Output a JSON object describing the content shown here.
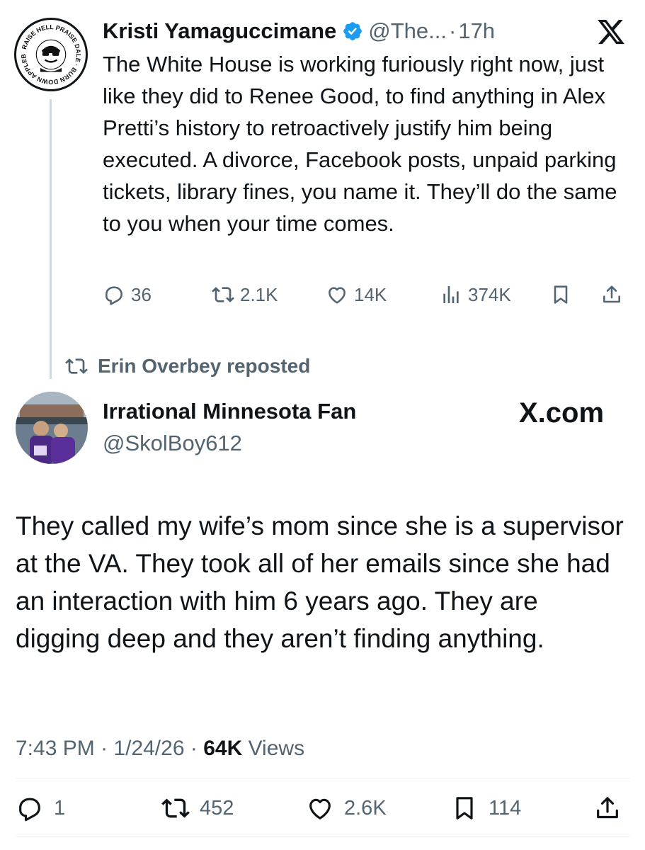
{
  "parent_tweet": {
    "display_name": "Kristi Yamaguccimane",
    "handle": "@The...",
    "separator": "·",
    "time": "17h",
    "avatar_text": "RAISE HELL PRAISE DALE BURN DOWN APPLEBEE'S",
    "text": "The White House is working furiously right now, just like they did to Renee Good, to find anything in Alex Pretti’s history to retroactively justify him being executed. A divorce, Facebook posts, unpaid parking tickets, library fines, you name it. They’ll do the same to you when your time comes.",
    "actions": {
      "replies": "36",
      "reposts": "2.1K",
      "likes": "14K",
      "views": "374K"
    }
  },
  "repost_banner": {
    "label": "Erin Overbey reposted"
  },
  "main_tweet": {
    "display_name": "Irrational Minnesota Fan",
    "handle": "@SkolBoy612",
    "brand": "X.com",
    "text": "They called my wife’s mom since she is a supervisor at the VA. They took all of her emails since she had an interaction with him 6 years ago. They are digging deep and they aren’t finding anything.",
    "meta": {
      "time": "7:43 PM",
      "separator": "·",
      "date": "1/24/26",
      "views_count": "64K",
      "views_label": "Views"
    },
    "actions": {
      "replies": "1",
      "reposts": "452",
      "likes": "2.6K",
      "bookmarks": "114"
    }
  },
  "colors": {
    "text_primary": "#0f1419",
    "text_secondary": "#536471",
    "verified": "#1d9bf0",
    "divider": "#eff3f4",
    "thread_line": "#cfd9de"
  },
  "icons": [
    "x-logo-icon",
    "verified-badge-icon",
    "reply-icon",
    "repost-icon",
    "like-icon",
    "views-icon",
    "bookmark-icon",
    "share-icon"
  ]
}
